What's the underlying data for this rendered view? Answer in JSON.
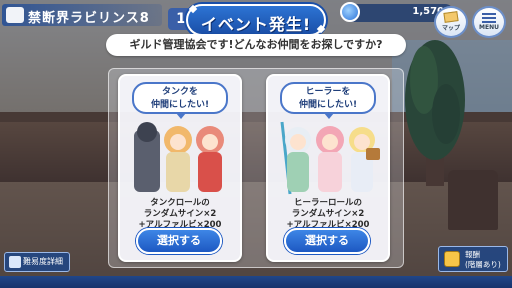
{
  "hud": {
    "location_title": "禁断界ラビリンス8",
    "level": "1",
    "jewel_count": "1,570",
    "map_label": "マップ",
    "menu_label": "MENU"
  },
  "event": {
    "banner": "イベント発生!",
    "question": "ギルド管理協会です!どんなお仲間をお探しですか?"
  },
  "options": [
    {
      "bubble_line1": "タンクを",
      "bubble_line2": "仲間にしたい!",
      "reward_line1": "タンクロールの",
      "reward_line2": "ランダムサイン×2",
      "reward_line3": "+アルファルビ×200",
      "button": "選択する"
    },
    {
      "bubble_line1": "ヒーラーを",
      "bubble_line2": "仲間にしたい!",
      "reward_line1": "ヒーラーロールの",
      "reward_line2": "ランダムサイン×2",
      "reward_line3": "+アルファルビ×200",
      "button": "選択する"
    }
  ],
  "bottom": {
    "detail_button": "難易度詳細",
    "reward_line1": "報酬",
    "reward_line2": "(階層あり)"
  },
  "colors": {
    "accent_blue": "#1d58c2",
    "banner_blue": "#2d74d4",
    "jewel": "#2a72d8"
  }
}
